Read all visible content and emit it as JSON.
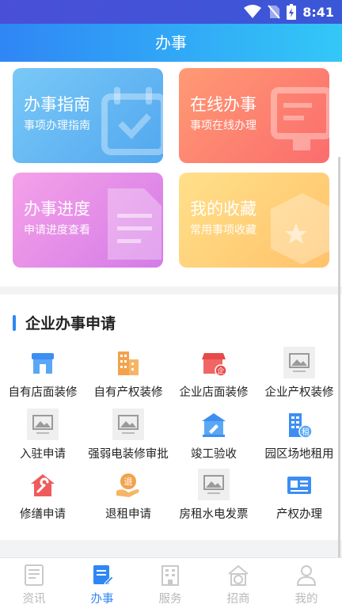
{
  "status": {
    "time": "8:41"
  },
  "header": {
    "title": "办事"
  },
  "cards": [
    {
      "title": "办事指南",
      "subtitle": "事项办理指南"
    },
    {
      "title": "在线办事",
      "subtitle": "事项在线办理"
    },
    {
      "title": "办事进度",
      "subtitle": "申请进度查看"
    },
    {
      "title": "我的收藏",
      "subtitle": "常用事项收藏"
    }
  ],
  "section": {
    "title": "企业办事申请",
    "items": [
      {
        "label": "自有店面装修",
        "icon": "storefront-icon"
      },
      {
        "label": "自有产权装修",
        "icon": "buildings-icon"
      },
      {
        "label": "企业店面装修",
        "icon": "enterprise-store-icon"
      },
      {
        "label": "企业产权装修",
        "icon": "image-placeholder-icon"
      },
      {
        "label": "入驻申请",
        "icon": "image-placeholder-icon"
      },
      {
        "label": "强弱电装修审批",
        "icon": "image-placeholder-icon"
      },
      {
        "label": "竣工验收",
        "icon": "inspection-building-icon"
      },
      {
        "label": "园区场地租用",
        "icon": "rent-building-icon"
      },
      {
        "label": "修缮申请",
        "icon": "repair-house-icon"
      },
      {
        "label": "退租申请",
        "icon": "refund-hand-icon"
      },
      {
        "label": "房租水电发票",
        "icon": "image-placeholder-icon"
      },
      {
        "label": "产权办理",
        "icon": "certificate-icon"
      }
    ]
  },
  "tabs": [
    {
      "label": "资讯",
      "icon": "news-icon",
      "active": false
    },
    {
      "label": "办事",
      "icon": "handle-affairs-icon",
      "active": true
    },
    {
      "label": "服务",
      "icon": "service-building-icon",
      "active": false
    },
    {
      "label": "招商",
      "icon": "investment-icon",
      "active": false
    },
    {
      "label": "我的",
      "icon": "profile-icon",
      "active": false
    }
  ],
  "colors": {
    "primary": "#2f86f5",
    "inactive": "#b9b9b9"
  }
}
